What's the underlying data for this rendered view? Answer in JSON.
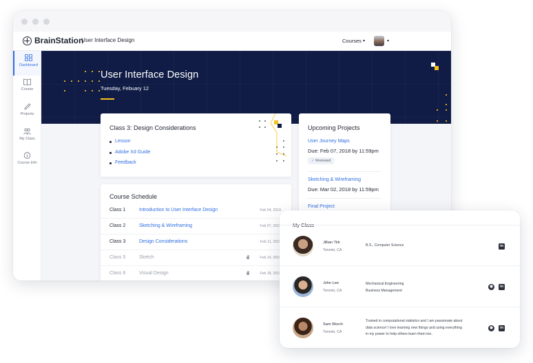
{
  "app": {
    "brand": "BrainStation",
    "course": "User Interface Design"
  },
  "nav": {
    "courses_label": "Courses",
    "caret": "▾"
  },
  "sidebar": {
    "items": [
      {
        "label": "Dashboard",
        "icon": "grid-icon",
        "active": true
      },
      {
        "label": "Course",
        "icon": "book-icon"
      },
      {
        "label": "Projects",
        "icon": "pencil-icon"
      },
      {
        "label": "My Class",
        "icon": "people-icon"
      },
      {
        "label": "Course Info",
        "icon": "info-icon"
      }
    ]
  },
  "hero": {
    "title": "User Interface Design",
    "date": "Tuesday, Febuary 12"
  },
  "class_card": {
    "title": "Class 3: Design Considerations",
    "links": [
      "Lesson",
      "Adobe Xd Guide",
      "Feedback"
    ]
  },
  "projects": {
    "title": "Upcoming Projects",
    "items": [
      {
        "name": "User Journey Maps",
        "due": "Due: Feb 07, 2018 by 11:59pm",
        "badge": "Reviewed"
      },
      {
        "name": "Sketching & Wireframing",
        "due": "Due: Mar 02, 2018 by 11:59pm"
      },
      {
        "name": "Final Project"
      }
    ]
  },
  "schedule": {
    "title": "Course Schedule",
    "rows": [
      {
        "class": "Class 1",
        "name": "Introduction to User Interface Design",
        "date": "Feb 04, 2019",
        "locked": false
      },
      {
        "class": "Class 2",
        "name": "Sketching & Wireframing",
        "date": "Feb 07, 2019",
        "locked": false
      },
      {
        "class": "Class 3",
        "name": "Design Considerations",
        "date": "Feb 11, 2019",
        "locked": false
      },
      {
        "class": "Class 5",
        "name": "Sketch",
        "date": "Feb 14, 2019",
        "locked": true
      },
      {
        "class": "Class 6",
        "name": "Visual Design",
        "date": "Feb 18, 2019",
        "locked": true
      }
    ]
  },
  "my_class": {
    "title": "My Class",
    "members": [
      {
        "name": "Jillian Tirk",
        "location": "Toronto, CA",
        "info": "B.S., Computer Science",
        "links": [
          "linkedin-icon"
        ]
      },
      {
        "name": "John Lee",
        "location": "Toronto, CA",
        "info": "Mechanical Engineering\nBusiness Management",
        "links": [
          "github-icon",
          "linkedin-icon"
        ]
      },
      {
        "name": "Sam Worch",
        "location": "Toronto, CA",
        "info": "Trained in computational statistics and I am passionate about data science! I love learning new things and using everything in my power to help others learn them too.",
        "links": [
          "github-icon",
          "linkedin-icon"
        ]
      }
    ]
  },
  "colors": {
    "navy": "#101c45",
    "accent": "#2f6de0",
    "yellow": "#f6c21b"
  }
}
